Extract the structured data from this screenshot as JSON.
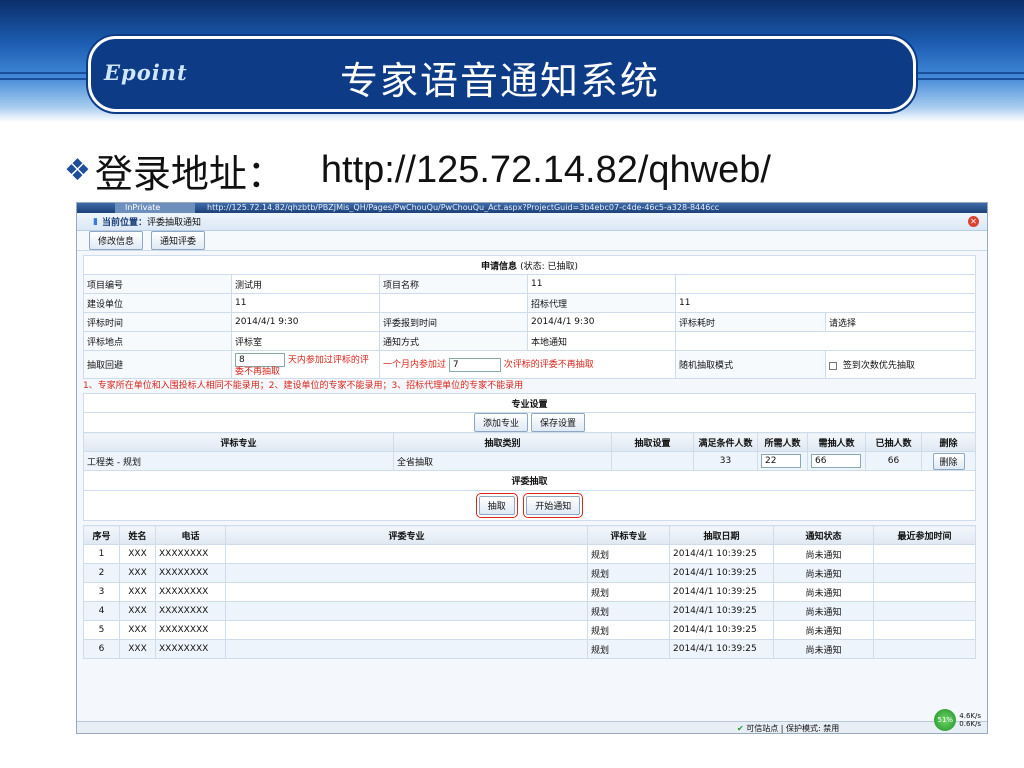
{
  "slide": {
    "logo": "Epoint",
    "title": "专家语音通知系统",
    "login_label": "登录地址：",
    "login_url": "http://125.72.14.82/qhweb/"
  },
  "browser": {
    "tab": "InPrivate",
    "url": "http://125.72.14.82/qhzbtb/PBZJMis_QH/Pages/PwChouQu/PwChouQu_Act.aspx?ProjectGuid=3b4ebc07-c4de-46c5-a328-8446cc",
    "location_label": "当前位置：",
    "location_value": "评委抽取通知",
    "zone_text": "可信站点 | 保护模式: 禁用",
    "speed_pct": "51%",
    "speed_up": "4.6K/s",
    "speed_down": "0.6K/s"
  },
  "toolbar": {
    "edit_label": "修改信息",
    "notify_label": "通知评委"
  },
  "apply": {
    "title": "申请信息",
    "status": "(状态: 已抽取)",
    "rows": {
      "proj_no_label": "项目编号",
      "proj_no": "测试用",
      "proj_name_label": "项目名称",
      "proj_name": "11",
      "unit_label": "建设单位",
      "unit": "11",
      "agent_label": "招标代理",
      "agent": "11",
      "eval_time_label": "评标时间",
      "eval_time": "2014/4/1 9:30",
      "arrive_label": "评委报到时间",
      "arrive": "2014/4/1 9:30",
      "duration_label": "评标耗时",
      "duration": "请选择",
      "place_label": "评标地点",
      "place": "评标室",
      "notify_label": "通知方式",
      "notify": "本地通知",
      "avoid_label": "抽取回避",
      "days": "8",
      "days_text": "天内参加过评标的评委不再抽取",
      "month_text": "一个月内参加过",
      "times": "7",
      "times_text": "次评标的评委不再抽取",
      "random_label": "随机抽取模式",
      "priority_text": "签到次数优先抽取"
    },
    "note": "1、专家所在单位和入围投标人相同不能录用；2、建设单位的专家不能录用；3、招标代理单位的专家不能录用"
  },
  "major": {
    "title": "专业设置",
    "add_label": "添加专业",
    "save_label": "保存设置",
    "headers": [
      "评标专业",
      "抽取类别",
      "抽取设置",
      "满足条件人数",
      "所需人数",
      "需抽人数",
      "已抽人数",
      "删除"
    ],
    "row": {
      "major": "工程类 - 规划",
      "type": "全省抽取",
      "setting": "",
      "satisfy": "33",
      "need": "22",
      "extract": "66",
      "extracted": "66",
      "delete_label": "删除"
    }
  },
  "draw": {
    "title": "评委抽取",
    "draw_label": "抽取",
    "notify_label": "开始通知"
  },
  "experts": {
    "headers": [
      "序号",
      "姓名",
      "电话",
      "评委专业",
      "评标专业",
      "抽取日期",
      "通知状态",
      "最近参加时间"
    ],
    "rows": [
      [
        "1",
        "XXX",
        "XXXXXXXX",
        "",
        "规划",
        "2014/4/1 10:39:25",
        "尚未通知",
        ""
      ],
      [
        "2",
        "XXX",
        "XXXXXXXX",
        "",
        "规划",
        "2014/4/1 10:39:25",
        "尚未通知",
        ""
      ],
      [
        "3",
        "XXX",
        "XXXXXXXX",
        "",
        "规划",
        "2014/4/1 10:39:25",
        "尚未通知",
        ""
      ],
      [
        "4",
        "XXX",
        "XXXXXXXX",
        "",
        "规划",
        "2014/4/1 10:39:25",
        "尚未通知",
        ""
      ],
      [
        "5",
        "XXX",
        "XXXXXXXX",
        "",
        "规划",
        "2014/4/1 10:39:25",
        "尚未通知",
        ""
      ],
      [
        "6",
        "XXX",
        "XXXXXXXX",
        "",
        "规划",
        "2014/4/1 10:39:25",
        "尚未通知",
        ""
      ]
    ]
  }
}
